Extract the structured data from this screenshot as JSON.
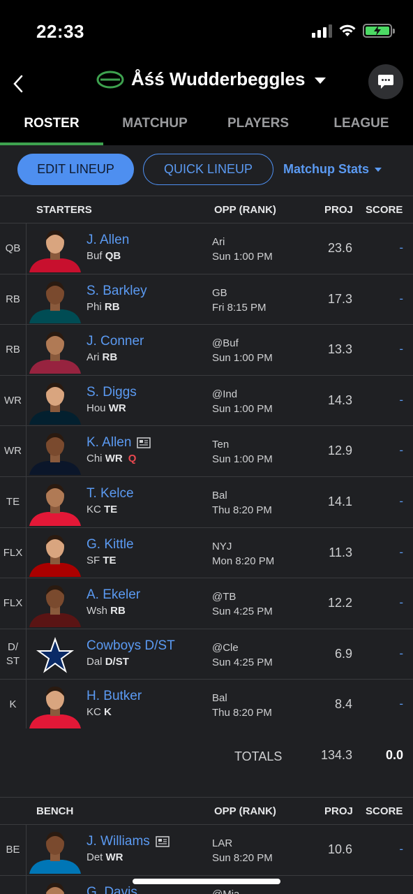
{
  "status": {
    "time": "22:33"
  },
  "header": {
    "team_name": "Åśś Wudderbeggles"
  },
  "tabs": [
    "ROSTER",
    "MATCHUP",
    "PLAYERS",
    "LEAGUE"
  ],
  "actions": {
    "edit": "EDIT LINEUP",
    "quick": "QUICK LINEUP",
    "stats": "Matchup Stats"
  },
  "columns": {
    "starters": "STARTERS",
    "bench": "BENCH",
    "opp": "OPP (RANK)",
    "proj": "PROJ",
    "score": "SCORE"
  },
  "starters": [
    {
      "slot": "QB",
      "name": "J. Allen",
      "team": "Buf",
      "pos": "QB",
      "opp": "Ari",
      "time": "Sun 1:00 PM",
      "proj": "23.6",
      "score": "-"
    },
    {
      "slot": "RB",
      "name": "S. Barkley",
      "team": "Phi",
      "pos": "RB",
      "opp": "GB",
      "time": "Fri 8:15 PM",
      "proj": "17.3",
      "score": "-"
    },
    {
      "slot": "RB",
      "name": "J. Conner",
      "team": "Ari",
      "pos": "RB",
      "opp": "@Buf",
      "time": "Sun 1:00 PM",
      "proj": "13.3",
      "score": "-"
    },
    {
      "slot": "WR",
      "name": "S. Diggs",
      "team": "Hou",
      "pos": "WR",
      "opp": "@Ind",
      "time": "Sun 1:00 PM",
      "proj": "14.3",
      "score": "-"
    },
    {
      "slot": "WR",
      "name": "K. Allen",
      "team": "Chi",
      "pos": "WR",
      "injury": "Q",
      "news": true,
      "opp": "Ten",
      "time": "Sun 1:00 PM",
      "proj": "12.9",
      "score": "-"
    },
    {
      "slot": "TE",
      "name": "T. Kelce",
      "team": "KC",
      "pos": "TE",
      "opp": "Bal",
      "time": "Thu 8:20 PM",
      "proj": "14.1",
      "score": "-"
    },
    {
      "slot": "FLX",
      "name": "G. Kittle",
      "team": "SF",
      "pos": "TE",
      "opp": "NYJ",
      "time": "Mon 8:20 PM",
      "proj": "11.3",
      "score": "-"
    },
    {
      "slot": "FLX",
      "name": "A. Ekeler",
      "team": "Wsh",
      "pos": "RB",
      "opp": "@TB",
      "time": "Sun 4:25 PM",
      "proj": "12.2",
      "score": "-"
    },
    {
      "slot": "D/\nST",
      "name": "Cowboys D/ST",
      "team": "Dal",
      "pos": "D/ST",
      "opp": "@Cle",
      "time": "Sun 4:25 PM",
      "proj": "6.9",
      "score": "-",
      "dst": true
    },
    {
      "slot": "K",
      "name": "H. Butker",
      "team": "KC",
      "pos": "K",
      "opp": "Bal",
      "time": "Thu 8:20 PM",
      "proj": "8.4",
      "score": "-"
    }
  ],
  "totals": {
    "label": "TOTALS",
    "proj": "134.3",
    "score": "0.0"
  },
  "bench": [
    {
      "slot": "BE",
      "name": "J. Williams",
      "team": "Det",
      "pos": "WR",
      "news": true,
      "opp": "LAR",
      "time": "Sun 8:20 PM",
      "proj": "10.6",
      "score": "-"
    },
    {
      "slot": "BE",
      "name": "G. Davis",
      "team": "",
      "pos": "",
      "opp": "@Mia",
      "time": "",
      "proj": "",
      "score": ""
    }
  ],
  "colors": {
    "accent": "#5b9af2",
    "active_tab": "#3ea24f",
    "injury": "#e8484f"
  }
}
